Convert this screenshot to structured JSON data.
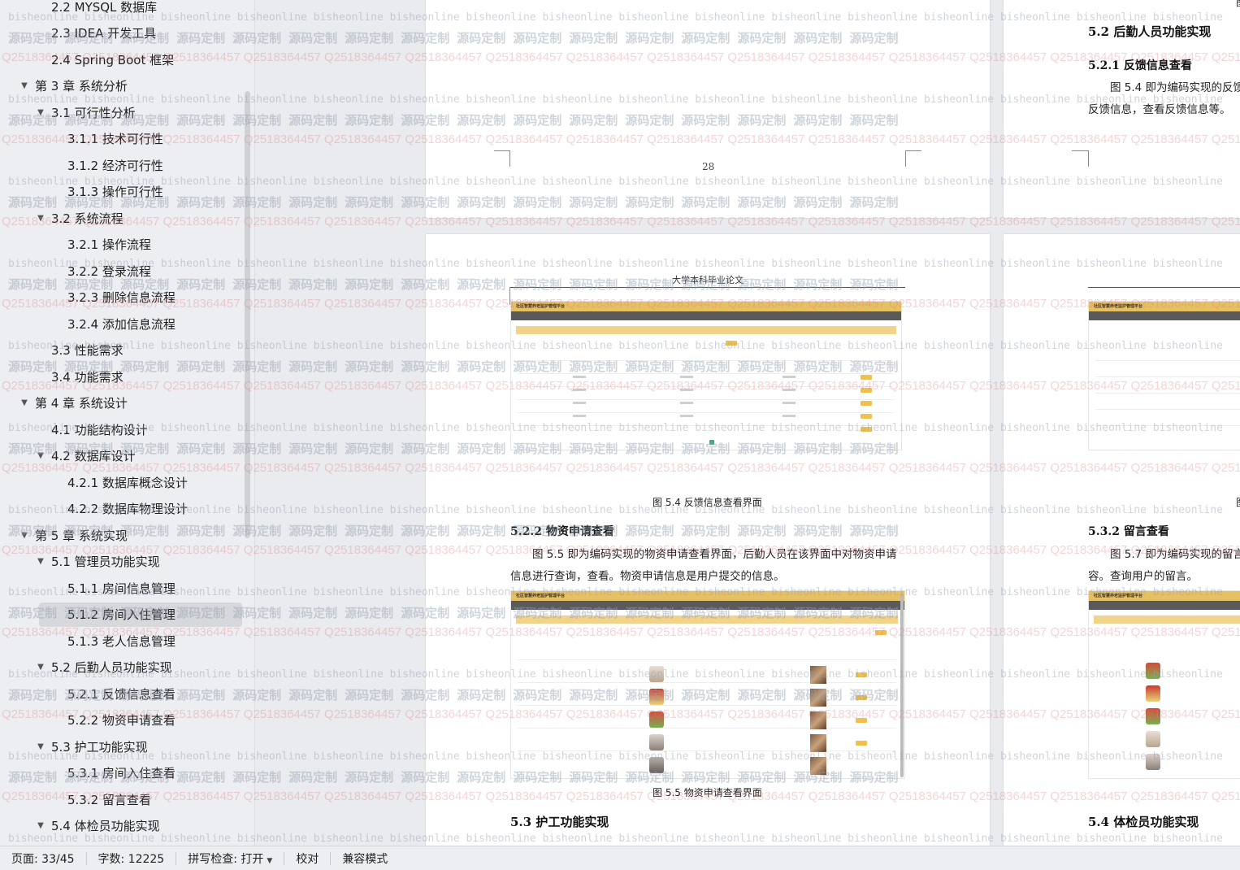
{
  "outline": [
    {
      "label": "2.2 MYSQL 数据库",
      "level": 2
    },
    {
      "label": "2.3 IDEA 开发工具",
      "level": 2
    },
    {
      "label": "2.4 Spring Boot 框架",
      "level": 2
    },
    {
      "label": "第 3 章  系统分析",
      "level": 1,
      "expanded": true
    },
    {
      "label": "3.1  可行性分析",
      "level": 2,
      "expanded": true
    },
    {
      "label": "3.1.1  技术可行性",
      "level": 3
    },
    {
      "label": "3.1.2  经济可行性",
      "level": 3
    },
    {
      "label": "3.1.3  操作可行性",
      "level": 3
    },
    {
      "label": "3.2  系统流程",
      "level": 2,
      "expanded": true
    },
    {
      "label": "3.2.1  操作流程",
      "level": 3
    },
    {
      "label": "3.2.2  登录流程",
      "level": 3
    },
    {
      "label": "3.2.3  删除信息流程",
      "level": 3
    },
    {
      "label": "3.2.4  添加信息流程",
      "level": 3
    },
    {
      "label": "3.3  性能需求",
      "level": 2
    },
    {
      "label": "3.4  功能需求",
      "level": 2
    },
    {
      "label": "第 4 章  系统设计",
      "level": 1,
      "expanded": true
    },
    {
      "label": "4.1  功能结构设计",
      "level": 2
    },
    {
      "label": "4.2  数据库设计",
      "level": 2,
      "expanded": true
    },
    {
      "label": "4.2.1  数据库概念设计",
      "level": 3
    },
    {
      "label": "4.2.2  数据库物理设计",
      "level": 3
    },
    {
      "label": "第 5 章  系统实现",
      "level": 1,
      "expanded": true
    },
    {
      "label": "5.1  管理员功能实现",
      "level": 2,
      "expanded": true
    },
    {
      "label": "5.1.1  房间信息管理",
      "level": 3
    },
    {
      "label": "5.1.2  房间入住管理",
      "level": 3,
      "selected": true
    },
    {
      "label": "5.1.3  老人信息管理",
      "level": 3
    },
    {
      "label": "5.2  后勤人员功能实现",
      "level": 2,
      "expanded": true
    },
    {
      "label": "5.2.1  反馈信息查看",
      "level": 3
    },
    {
      "label": "5.2.2  物资申请查看",
      "level": 3
    },
    {
      "label": "5.3  护工功能实现",
      "level": 2,
      "expanded": true
    },
    {
      "label": "5.3.1  房间入住查看",
      "level": 3
    },
    {
      "label": "5.3.2  留言查看",
      "level": 3
    },
    {
      "label": "5.4  体检员功能实现",
      "level": 2,
      "expanded": true
    }
  ],
  "pages": {
    "left_top": {
      "page_number": "28"
    },
    "left_bottom": {
      "header": "大学本科毕业论文",
      "fig1_caption": "图 5.4  反馈信息查看界面",
      "section_522": "5.2.2  物资申请查看",
      "para_line1": "图 5.5 即为编码实现的物资申请查看界面，后勤人员在该界面中对物资申请",
      "para_line2": "信息进行查询，查看。物资申请信息是用户提交的信息。",
      "fig2_caption": "图 5.5  物资申请查看界面",
      "section_53": "5.3  护工功能实现",
      "shot_title": "社区智慧养老监护管理平台"
    },
    "right_top": {
      "section_52": "5.2  后勤人员功能实现",
      "section_521": "5.2.1  反馈信息查看",
      "para_line1": "图 5.4 即为编码实现的反馈",
      "para_line2": "反馈信息，查看反馈信息等。",
      "corner_char": "图"
    },
    "right_bottom": {
      "fig_prefix": "图",
      "section_532": "5.3.2  留言查看",
      "para_line1": "图 5.7 即为编码实现的留言",
      "para_line2": "容。查询用户的留言。",
      "section_54": "5.4  体检员功能实现",
      "shot_title": "社区智慧养老监护管理平台"
    }
  },
  "watermark": {
    "text_a": "bisheonline",
    "text_b": "源码定制",
    "text_c": "Q2518364457"
  },
  "statusbar": {
    "page": "页面: 33/45",
    "words": "字数: 12225",
    "spellcheck": "拼写检查: 打开",
    "proofread": "校对",
    "compat": "兼容模式"
  },
  "colors": {
    "sidebar_bg": "#edeef1",
    "doc_bg": "#e9ebee",
    "accent_gold": "#e6c163"
  }
}
